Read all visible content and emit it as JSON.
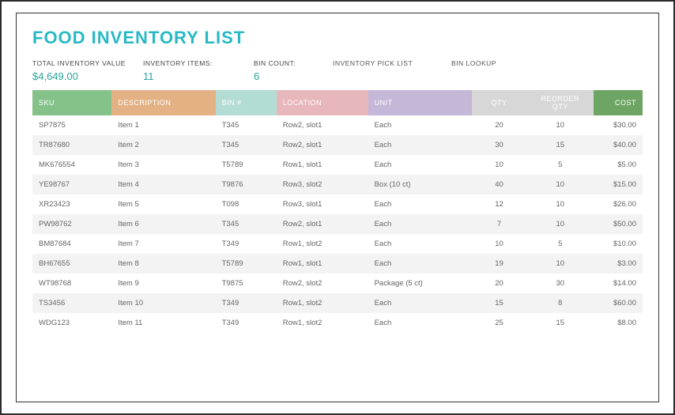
{
  "title": "FOOD INVENTORY LIST",
  "summary": {
    "total_label": "TOTAL INVENTORY VALUE",
    "total_value": "$4,649.00",
    "items_label": "INVENTORY ITEMS:",
    "items_value": "11",
    "bin_count_label": "BIN COUNT:",
    "bin_count_value": "6",
    "pick_list_label": "INVENTORY PICK LIST",
    "bin_lookup_label": "BIN LOOKUP"
  },
  "headers": {
    "sku": "SKU",
    "description": "DESCRIPTION",
    "bin": "BIN #",
    "location": "LOCATION",
    "unit": "UNIT",
    "qty": "QTY",
    "reorder": "REORDER QTY",
    "cost": "COST"
  },
  "rows": [
    {
      "sku": "SP7875",
      "description": "Item 1",
      "bin": "T345",
      "location": "Row2, slot1",
      "unit": "Each",
      "qty": "20",
      "reorder": "10",
      "cost": "$30.00"
    },
    {
      "sku": "TR87680",
      "description": "Item 2",
      "bin": "T345",
      "location": "Row2, slot1",
      "unit": "Each",
      "qty": "30",
      "reorder": "15",
      "cost": "$40.00"
    },
    {
      "sku": "MK676554",
      "description": "Item 3",
      "bin": "T5789",
      "location": "Row1, slot1",
      "unit": "Each",
      "qty": "10",
      "reorder": "5",
      "cost": "$5.00"
    },
    {
      "sku": "YE98767",
      "description": "Item 4",
      "bin": "T9876",
      "location": "Row3, slot2",
      "unit": "Box (10 ct)",
      "qty": "40",
      "reorder": "10",
      "cost": "$15.00"
    },
    {
      "sku": "XR23423",
      "description": "Item 5",
      "bin": "T098",
      "location": "Row3, slot1",
      "unit": "Each",
      "qty": "12",
      "reorder": "10",
      "cost": "$26.00"
    },
    {
      "sku": "PW98762",
      "description": "Item 6",
      "bin": "T345",
      "location": "Row2, slot1",
      "unit": "Each",
      "qty": "7",
      "reorder": "10",
      "cost": "$50.00"
    },
    {
      "sku": "BM87684",
      "description": "Item 7",
      "bin": "T349",
      "location": "Row1, slot2",
      "unit": "Each",
      "qty": "10",
      "reorder": "5",
      "cost": "$10.00"
    },
    {
      "sku": "BH67655",
      "description": "Item 8",
      "bin": "T5789",
      "location": "Row1, slot1",
      "unit": "Each",
      "qty": "19",
      "reorder": "10",
      "cost": "$3.00"
    },
    {
      "sku": "WT98768",
      "description": "Item 9",
      "bin": "T9875",
      "location": "Row2, slot2",
      "unit": "Package (5 ct)",
      "qty": "20",
      "reorder": "30",
      "cost": "$14.00"
    },
    {
      "sku": "TS3456",
      "description": "Item 10",
      "bin": "T349",
      "location": "Row1, slot2",
      "unit": "Each",
      "qty": "15",
      "reorder": "8",
      "cost": "$60.00"
    },
    {
      "sku": "WDG123",
      "description": "Item 11",
      "bin": "T349",
      "location": "Row1, slot2",
      "unit": "Each",
      "qty": "25",
      "reorder": "15",
      "cost": "$8.00"
    }
  ]
}
